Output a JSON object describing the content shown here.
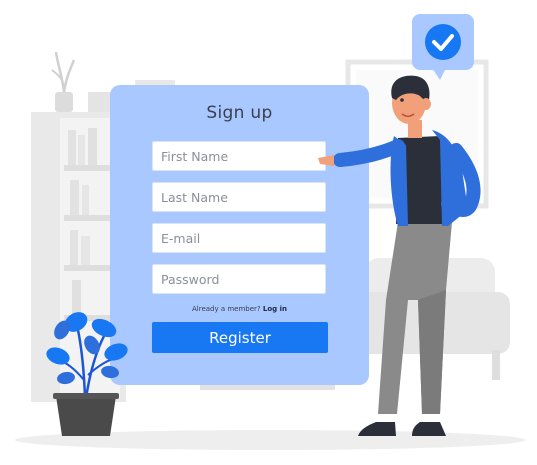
{
  "form": {
    "title": "Sign up",
    "first_name_placeholder": "First Name",
    "last_name_placeholder": "Last Name",
    "email_placeholder": "E-mail",
    "password_placeholder": "Password",
    "member_text": "Already a member?",
    "login_link": "Log in",
    "register_label": "Register"
  },
  "colors": {
    "card": "#a9c8ff",
    "accent": "#1877f2",
    "jacket": "#2f6fdb"
  },
  "icons": {
    "badge": "check-circle-icon"
  }
}
